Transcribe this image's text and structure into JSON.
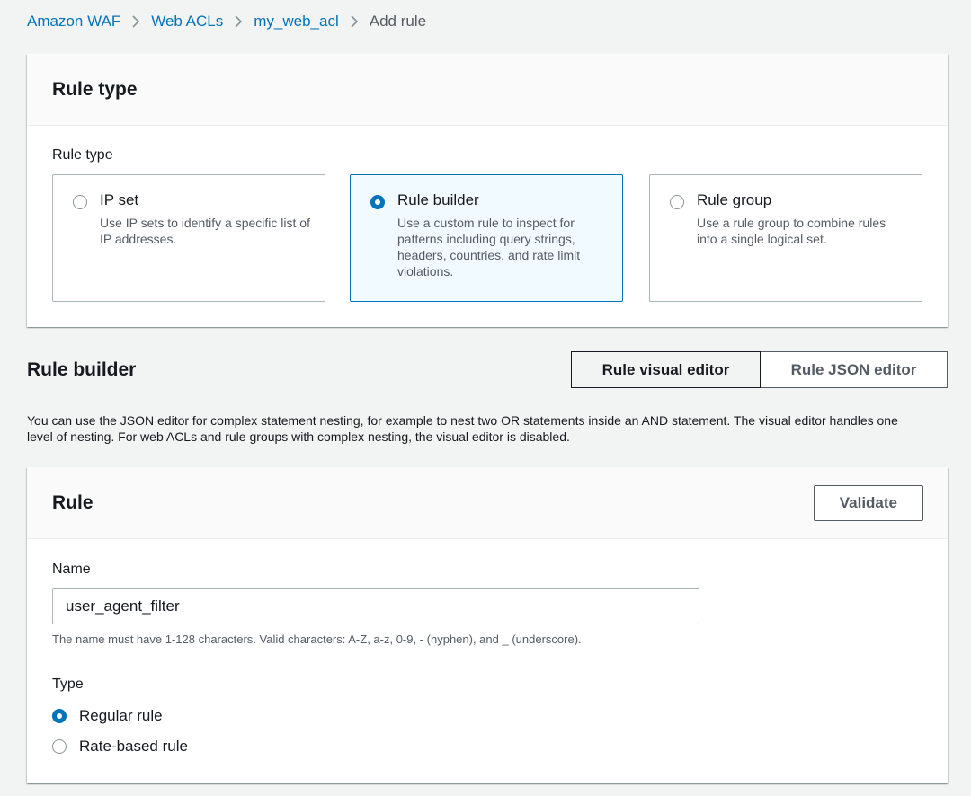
{
  "breadcrumb": {
    "items": [
      "Amazon WAF",
      "Web ACLs",
      "my_web_acl"
    ],
    "current": "Add rule"
  },
  "rule_type_panel": {
    "title": "Rule type",
    "field_label": "Rule type",
    "options": [
      {
        "title": "IP set",
        "description": "Use IP sets to identify a specific list of IP addresses.",
        "selected": false
      },
      {
        "title": "Rule builder",
        "description": "Use a custom rule to inspect for patterns including query strings, headers, countries, and rate limit violations.",
        "selected": true
      },
      {
        "title": "Rule group",
        "description": "Use a rule group to combine rules into a single logical set.",
        "selected": false
      }
    ]
  },
  "rule_builder": {
    "title": "Rule builder",
    "visual_editor_label": "Rule visual editor",
    "json_editor_label": "Rule JSON editor",
    "active_editor": "visual",
    "help_text": "You can use the JSON editor for complex statement nesting, for example to nest two OR statements inside an AND statement. The visual editor handles one level of nesting. For web ACLs and rule groups with complex nesting, the visual editor is disabled."
  },
  "rule_panel": {
    "title": "Rule",
    "validate_label": "Validate",
    "name_label": "Name",
    "name_value": "user_agent_filter",
    "name_constraint": "The name must have 1-128 characters. Valid characters: A-Z, a-z, 0-9, - (hyphen), and _ (underscore).",
    "type_label": "Type",
    "type_options": [
      {
        "label": "Regular rule",
        "selected": true
      },
      {
        "label": "Rate-based rule",
        "selected": false
      }
    ]
  },
  "colors": {
    "accent": "#0073bb",
    "selected_tile_bg": "#f1faff",
    "page_bg": "#f2f3f3"
  },
  "icons": {
    "breadcrumb_separator": "chevron-right-icon"
  }
}
